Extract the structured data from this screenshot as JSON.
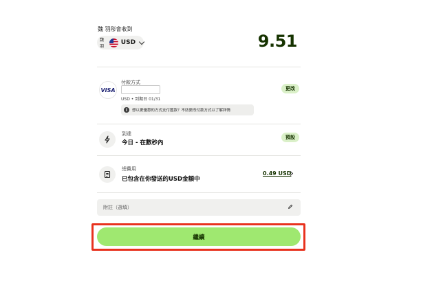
{
  "recipient": {
    "label": "魏 羽彤會收到",
    "currency_selector": {
      "short_name": "魏羽",
      "code": "USD"
    },
    "amount": "9.51"
  },
  "payment_method": {
    "label": "付款方式",
    "card_brand": "VISA",
    "card_meta": "USD • 到期日 01/31",
    "info_text": "想以更優惠的方式支付匯款？不妨更改付款方式以了解詳情",
    "action_label": "更改"
  },
  "arrival": {
    "label": "到達",
    "value": "今日 - 在數秒內",
    "action_label": "預設"
  },
  "fees": {
    "label": "總費用",
    "value": "已包含在你發送的USD金額中",
    "amount": "0.49 USD"
  },
  "note": {
    "placeholder": "附註（選填）"
  },
  "continue_button": {
    "label": "繼續"
  },
  "colors": {
    "accent_green": "#9fe870",
    "pill_green": "#daf0c8",
    "dark_green": "#163300",
    "highlight_red": "#e8321e"
  }
}
